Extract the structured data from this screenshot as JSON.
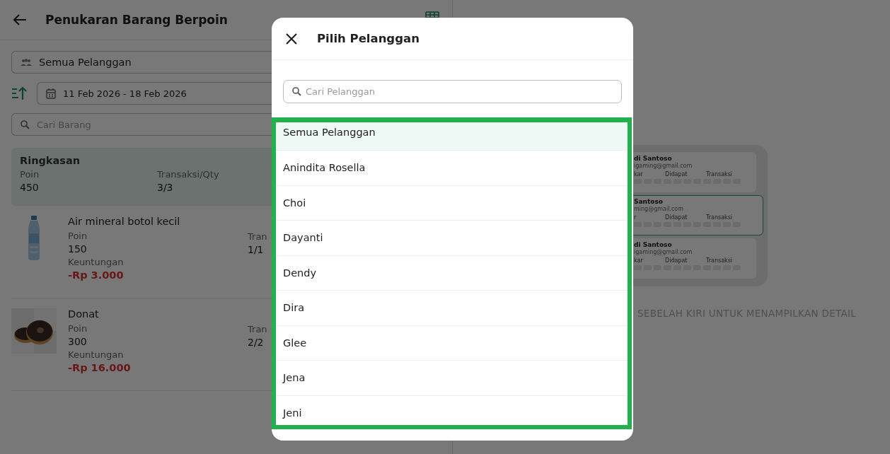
{
  "header": {
    "title": "Penukaran Barang Berpoin"
  },
  "customer_filter": {
    "value": "Semua Pelanggan"
  },
  "date_range": {
    "value": "11 Feb 2026 - 18 Feb 2026"
  },
  "item_search": {
    "placeholder": "Cari Barang"
  },
  "summary": {
    "title": "Ringkasan",
    "stats": [
      {
        "label": "Poin",
        "value": "450"
      },
      {
        "label": "Transaksi/Qty",
        "value": "3/3"
      }
    ]
  },
  "items": [
    {
      "kind": "picture",
      "name": "Air mineral botol kecil",
      "points_label": "Poin",
      "points": "150",
      "profit_label": "Keuntungan",
      "profit": "-Rp 3.000",
      "column_2_label": "Tran",
      "column_2_value": "1/1"
    },
    {
      "kind": "picture",
      "name": "Donat",
      "points_label": "Poin",
      "points": "300",
      "profit_label": "Keuntungan",
      "profit": "-Rp 16.000",
      "column_2_label": "Tran",
      "column_2_value": "2/2"
    }
  ],
  "empty_state": {
    "cards": [
      {
        "name": "di Santoso",
        "email": "igaming@gmail.com",
        "labels": [
          "kar",
          "Didapat",
          "Transaksi"
        ],
        "selected": false
      },
      {
        "name": "Santoso",
        "email": "ming@gmail.com",
        "labels": [
          "r",
          "Didapat",
          "Transaksi"
        ],
        "selected": true
      },
      {
        "name": "di Santoso",
        "email": "igaming@gmail.com",
        "labels": [
          "kar",
          "Didapat",
          "Transaksi"
        ],
        "selected": false
      }
    ],
    "caption": "SEBELAH KIRI UNTUK MENAMPILKAN DETAIL"
  },
  "dialog": {
    "title": "Pilih Pelanggan",
    "search": {
      "placeholder": "Cari Pelanggan"
    },
    "customers": [
      {
        "name": "Semua Pelanggan",
        "selected": true
      },
      {
        "name": "Anindita Rosella",
        "selected": false
      },
      {
        "name": "Choi",
        "selected": false
      },
      {
        "name": "Dayanti",
        "selected": false
      },
      {
        "name": "Dendy",
        "selected": false
      },
      {
        "name": "Dira",
        "selected": false
      },
      {
        "name": "Glee",
        "selected": false
      },
      {
        "name": "Jena",
        "selected": false
      },
      {
        "name": "Jeni",
        "selected": false
      }
    ]
  }
}
